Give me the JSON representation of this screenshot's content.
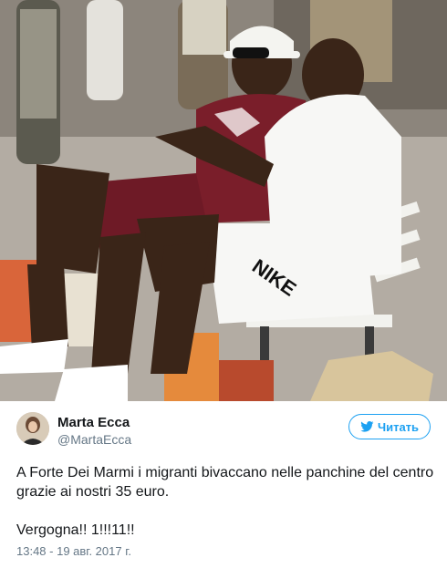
{
  "tweet": {
    "author": {
      "display_name": "Marta Ecca",
      "handle": "@MartaEcca"
    },
    "follow_button": {
      "label": "Читать",
      "icon": "twitter-bird-icon"
    },
    "text_lines": [
      "A Forte Dei Marmi i migranti bivaccano nelle panchine del centro grazie ai nostri 35 euro.",
      "Vergogna!! 1!!!11!!"
    ],
    "timestamp": "13:48 - 19 авг. 2017 г."
  },
  "colors": {
    "accent": "#1da1f2",
    "secondary_text": "#657786",
    "primary_text": "#14171a"
  },
  "photo": {
    "nike_text": "NIKE"
  }
}
